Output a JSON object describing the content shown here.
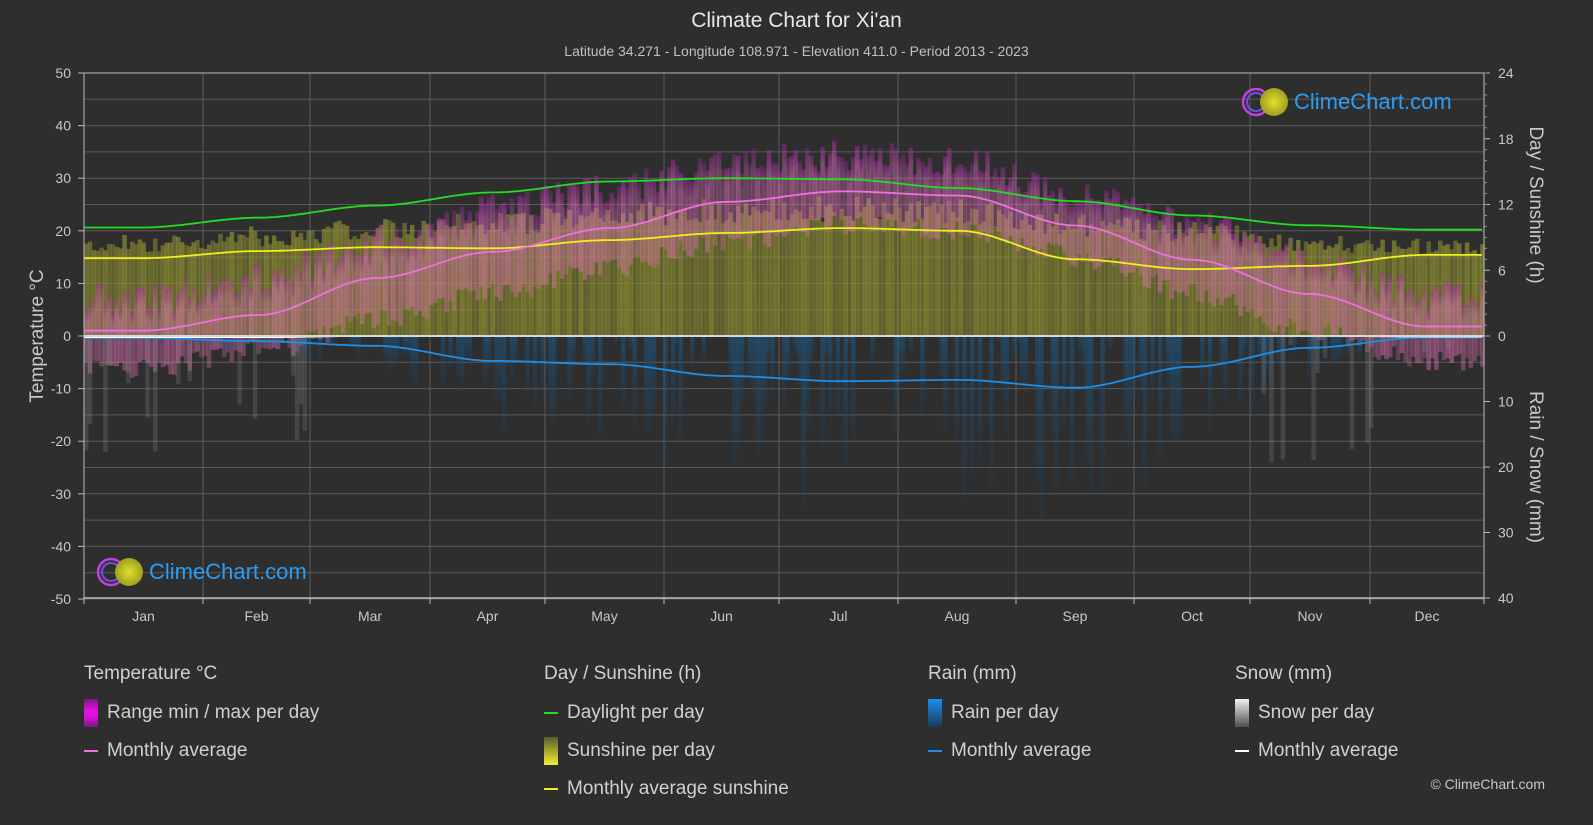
{
  "header": {
    "title": "Climate Chart for Xi'an",
    "subtitle": "Latitude 34.271 - Longitude 108.971 - Elevation 411.0 - Period 2013 - 2023"
  },
  "logo": {
    "text": "ClimeChart.com"
  },
  "copyright": "© ClimeChart.com",
  "colors": {
    "background": "#2e2e2e",
    "temp_range": "#e020e0",
    "temp_avg": "#f070e0",
    "daylight": "#22dd22",
    "sunshine_bar": "#c8c838",
    "sunshine_avg": "#f0f020",
    "rain_bar": "#1a6eb0",
    "rain_avg": "#1e8ee8",
    "snow_bar": "#909090",
    "snow_avg": "#ffffff",
    "logo_text": "#2a9df4"
  },
  "legend": {
    "groups": [
      {
        "title": "Temperature °C",
        "items": [
          {
            "label": "Range min / max per day",
            "swatch": "box",
            "icon": "temperature-range-swatch"
          },
          {
            "label": "Monthly average",
            "swatch": "line",
            "icon": "temperature-average-line"
          }
        ]
      },
      {
        "title": "Day / Sunshine (h)",
        "items": [
          {
            "label": "Daylight per day",
            "swatch": "line",
            "icon": "daylight-line"
          },
          {
            "label": "Sunshine per day",
            "swatch": "box",
            "icon": "sunshine-swatch"
          },
          {
            "label": "Monthly average sunshine",
            "swatch": "line",
            "icon": "sunshine-average-line"
          }
        ]
      },
      {
        "title": "Rain (mm)",
        "items": [
          {
            "label": "Rain per day",
            "swatch": "box",
            "icon": "rain-swatch"
          },
          {
            "label": "Monthly average",
            "swatch": "line",
            "icon": "rain-average-line"
          }
        ]
      },
      {
        "title": "Snow (mm)",
        "items": [
          {
            "label": "Snow per day",
            "swatch": "box",
            "icon": "snow-swatch"
          },
          {
            "label": "Monthly average",
            "swatch": "line",
            "icon": "snow-average-line"
          }
        ]
      }
    ]
  },
  "chart_data": {
    "type": "line",
    "title": "Climate Chart for Xi'an",
    "subtitle": "Latitude 34.271 - Longitude 108.971 - Elevation 411.0 - Period 2013 - 2023",
    "categories": [
      "Jan",
      "Feb",
      "Mar",
      "Apr",
      "May",
      "Jun",
      "Jul",
      "Aug",
      "Sep",
      "Oct",
      "Nov",
      "Dec"
    ],
    "axes": {
      "left": {
        "label": "Temperature °C",
        "range": [
          -50,
          50
        ],
        "ticks": [
          50,
          40,
          30,
          20,
          10,
          0,
          -10,
          -20,
          -30,
          -40,
          -50
        ]
      },
      "right_top": {
        "label": "Day / Sunshine (h)",
        "range": [
          0,
          24
        ],
        "ticks": [
          24,
          18,
          12,
          6,
          0
        ]
      },
      "right_bottom": {
        "label": "Rain / Snow (mm)",
        "range": [
          0,
          40
        ],
        "ticks": [
          0,
          10,
          20,
          30,
          40
        ],
        "inverted": true
      }
    },
    "grid": true,
    "legend_position": "bottom",
    "series": [
      {
        "name": "Temperature monthly average",
        "axis": "left",
        "unit": "°C",
        "values": [
          1.0,
          4.0,
          11.0,
          16.0,
          20.5,
          25.5,
          27.5,
          26.7,
          21.0,
          14.5,
          8.0,
          1.8
        ]
      },
      {
        "name": "Temperature max (approx. daily range top)",
        "axis": "left",
        "unit": "°C",
        "values": [
          6,
          10,
          17,
          23,
          27,
          32,
          33,
          32,
          26,
          20,
          13,
          7
        ]
      },
      {
        "name": "Temperature min (approx. daily range bottom)",
        "axis": "left",
        "unit": "°C",
        "values": [
          -4,
          -1,
          5,
          10,
          15,
          20,
          23,
          22,
          17,
          10,
          3,
          -3
        ]
      },
      {
        "name": "Daylight per day",
        "axis": "right_top",
        "unit": "h",
        "values": [
          9.9,
          10.8,
          11.9,
          13.1,
          14.1,
          14.4,
          14.3,
          13.5,
          12.3,
          11.0,
          10.1,
          9.7
        ]
      },
      {
        "name": "Sunshine per day (approx. upper envelope)",
        "axis": "right_top",
        "unit": "h",
        "values": [
          8.9,
          9.6,
          10.2,
          10.8,
          11.6,
          12.0,
          12.2,
          11.9,
          10.6,
          9.9,
          8.9,
          8.6
        ]
      },
      {
        "name": "Monthly average sunshine",
        "axis": "right_top",
        "unit": "h",
        "values": [
          7.1,
          7.75,
          8.1,
          8.0,
          8.75,
          9.4,
          9.85,
          9.6,
          7.0,
          6.1,
          6.4,
          7.4
        ]
      },
      {
        "name": "Rain monthly average",
        "axis": "right_bottom",
        "unit": "mm",
        "values": [
          0.3,
          0.8,
          1.5,
          3.8,
          4.3,
          6.1,
          6.9,
          6.7,
          7.9,
          4.7,
          1.8,
          0.2
        ]
      },
      {
        "name": "Snow monthly average",
        "axis": "right_bottom",
        "unit": "mm",
        "values": [
          0.2,
          0.2,
          0.0,
          0.0,
          0.0,
          0.0,
          0.0,
          0.0,
          0.0,
          0.0,
          0.0,
          0.1
        ]
      }
    ]
  }
}
